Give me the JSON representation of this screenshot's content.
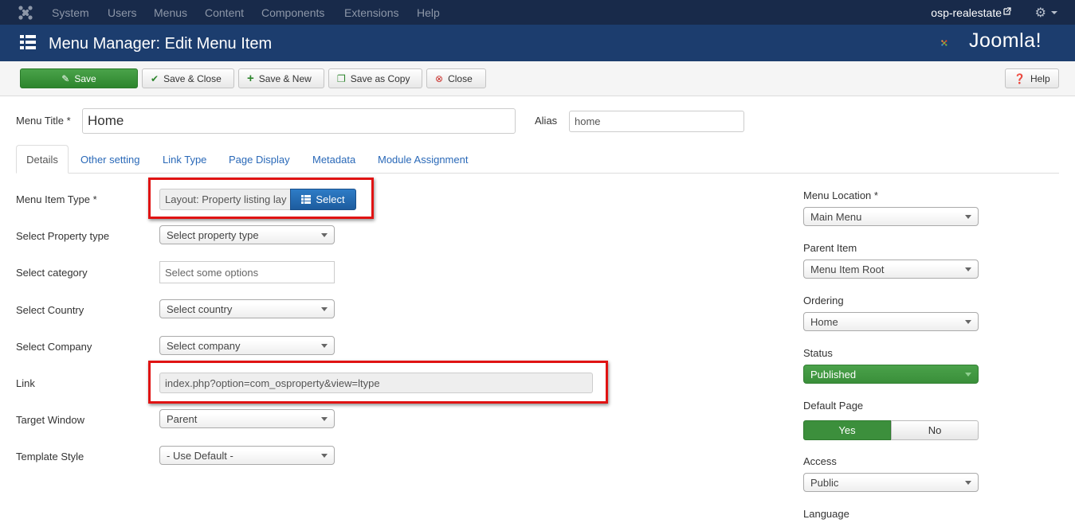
{
  "topnav": {
    "items": [
      "System",
      "Users",
      "Menus",
      "Content",
      "Components",
      "Extensions",
      "Help"
    ],
    "site_name": "osp-realestate"
  },
  "header": {
    "title": "Menu Manager: Edit Menu Item",
    "brand": "Joomla!"
  },
  "toolbar": {
    "save": "Save",
    "save_close": "Save & Close",
    "save_new": "Save & New",
    "save_copy": "Save as Copy",
    "close": "Close",
    "help": "Help"
  },
  "form": {
    "menu_title_label": "Menu Title *",
    "menu_title_value": "Home",
    "alias_label": "Alias",
    "alias_value": "home"
  },
  "tabs": [
    "Details",
    "Other setting",
    "Link Type",
    "Page Display",
    "Metadata",
    "Module Assignment"
  ],
  "details": {
    "menu_item_type_label": "Menu Item Type *",
    "menu_item_type_value": "Layout: Property listing lay",
    "select_button": "Select",
    "property_type_label": "Select Property type",
    "property_type_value": "Select property type",
    "category_label": "Select category",
    "category_placeholder": "Select some options",
    "country_label": "Select Country",
    "country_value": "Select country",
    "company_label": "Select Company",
    "company_value": "Select company",
    "link_label": "Link",
    "link_value": "index.php?option=com_osproperty&view=ltype",
    "target_window_label": "Target Window",
    "target_window_value": "Parent",
    "template_style_label": "Template Style",
    "template_style_value": "- Use Default -"
  },
  "sidebar": {
    "menu_location_label": "Menu Location *",
    "menu_location_value": "Main Menu",
    "parent_item_label": "Parent Item",
    "parent_item_value": "Menu Item Root",
    "ordering_label": "Ordering",
    "ordering_value": "Home",
    "status_label": "Status",
    "status_value": "Published",
    "default_page_label": "Default Page",
    "default_yes": "Yes",
    "default_no": "No",
    "access_label": "Access",
    "access_value": "Public",
    "language_label": "Language"
  },
  "colors": {
    "navbar": "#182a4a",
    "header": "#1c3d6e",
    "success": "#3c8f3c",
    "primary": "#2e7cc6",
    "highlight": "#e01313"
  }
}
